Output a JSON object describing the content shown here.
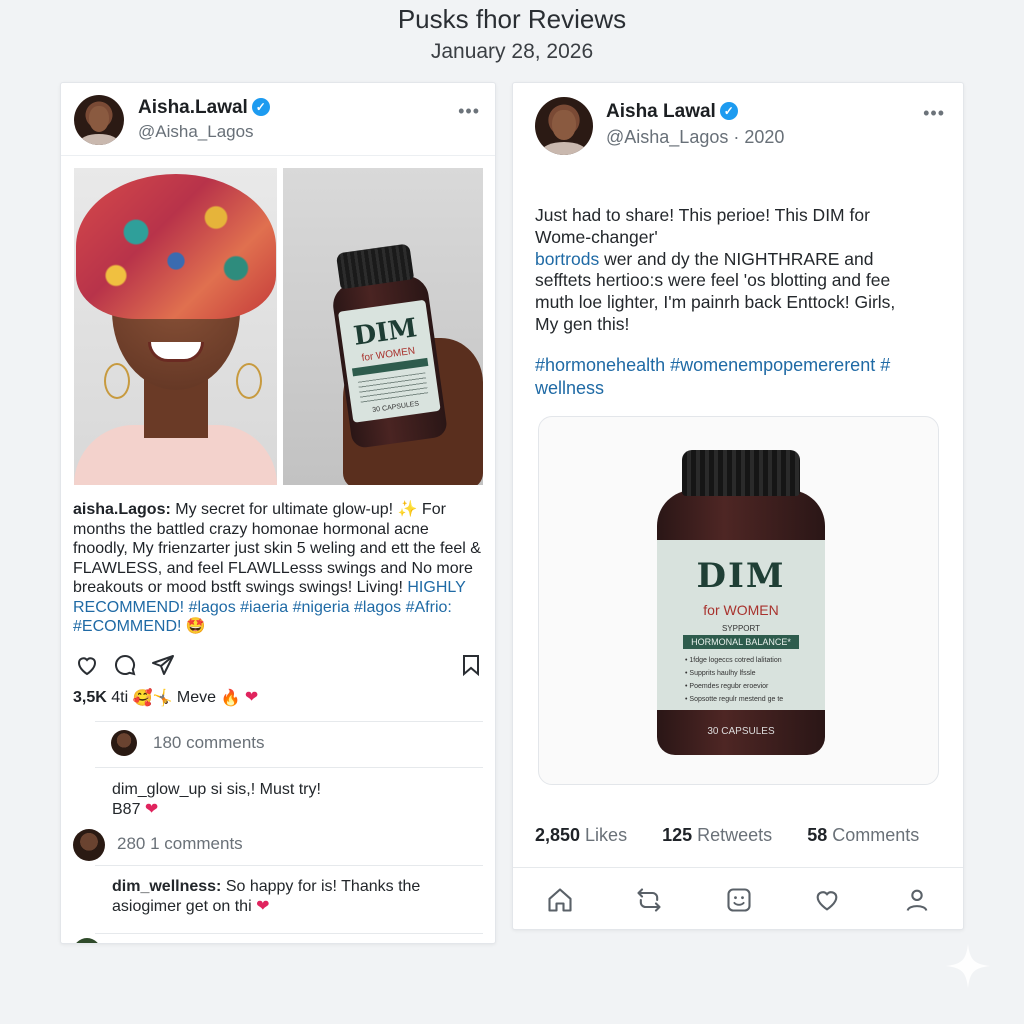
{
  "header": {
    "title": "Pusks fhor Reviews",
    "date": "January 28, 2026"
  },
  "left_post": {
    "author_name": "Aisha.Lawal",
    "handle": "@Aisha_Lagos",
    "more_label": "•••",
    "bottle_brand": "DIM",
    "bottle_sub": "for WOMEN",
    "bottle_count": "30 CAPSULES",
    "caption_user": "aisha.Lagos:",
    "caption_text": " My secret for ultimate glow-up! ✨ For months the battled crazy homonae hormonal acne fnoodly, My frienzarter just skin 5 weling and ett the feel & FLAWLESS, and feel FLAWLLesss swings and No more breakouts or mood bstft swings swings! Living! ",
    "caption_tags": "HIGHLY RECOMMEND! #lagos #iaeria #nigeria #lagos #Afrio: #ECOMMEND! ",
    "caption_emoji": "🤩",
    "likes": "3,5K",
    "likes_suffix": " 4ti",
    "likes_emojis_a": "🥰🤸",
    "likes_word": " Meve ",
    "likes_emojis_b": "🔥",
    "comments_link_1": "180 comments",
    "comment_1_user": "dim_glow_up",
    "comment_1_text": " si sis,! Must try!",
    "comment_1_text_2": "B87 ",
    "comments_link_2": "280 1 comments",
    "comment_2_user": "dim_wellness:",
    "comment_2_text": " So happy for is! Thanks the",
    "comment_2_text_2": "asiogimer get on thi "
  },
  "right_post": {
    "author_name": "Aisha Lawal",
    "handle": "@Aisha_Lagos",
    "year": "· 2020",
    "more_label": "•••",
    "body_line_1": "Just had to share! This perioe! This DIM for",
    "body_line_2": "Wome-changer'",
    "body_tag": "bortrods",
    "body_line_3": " wer and dy the NIGHTHRARE and",
    "body_line_4": "sefftets hertioo:s were feel 'os blotting and fee",
    "body_line_5": "muth loe lighter, I'm painrh back Enttock! Girls,",
    "body_line_6": "My gen this!",
    "hashtags": "#hormonehealth #womenempopemererent # wellness",
    "bottle_brand": "DIM",
    "bottle_sub": "for WOMEN",
    "bottle_support": "SYPPORT",
    "bottle_band": "HORMONAL BALANCE*",
    "bottle_list": [
      "• 1fdge logeccs cotred lalitation",
      "• Supprits haulhy lfssle",
      "• Poemdes regubr eroevior",
      "• Sopsotte regulr mestend ge te"
    ],
    "bottle_count": "30 CAPSULES",
    "likes_count": "2,850",
    "likes_label": " Likes",
    "retweets_count": "125",
    "retweets_label": " Retweets",
    "comments_count": "58",
    "comments_label": " Comments"
  },
  "colors": {
    "accent": "#1d9bf0",
    "hashtag": "#1f6aa5",
    "heart": "#e0245e"
  },
  "icons": [
    "verified-icon",
    "more-icon",
    "heart-icon",
    "comment-icon",
    "share-icon",
    "bookmark-icon",
    "home-icon",
    "retweet-icon",
    "emoji-icon",
    "profile-icon",
    "sparkle-icon"
  ]
}
